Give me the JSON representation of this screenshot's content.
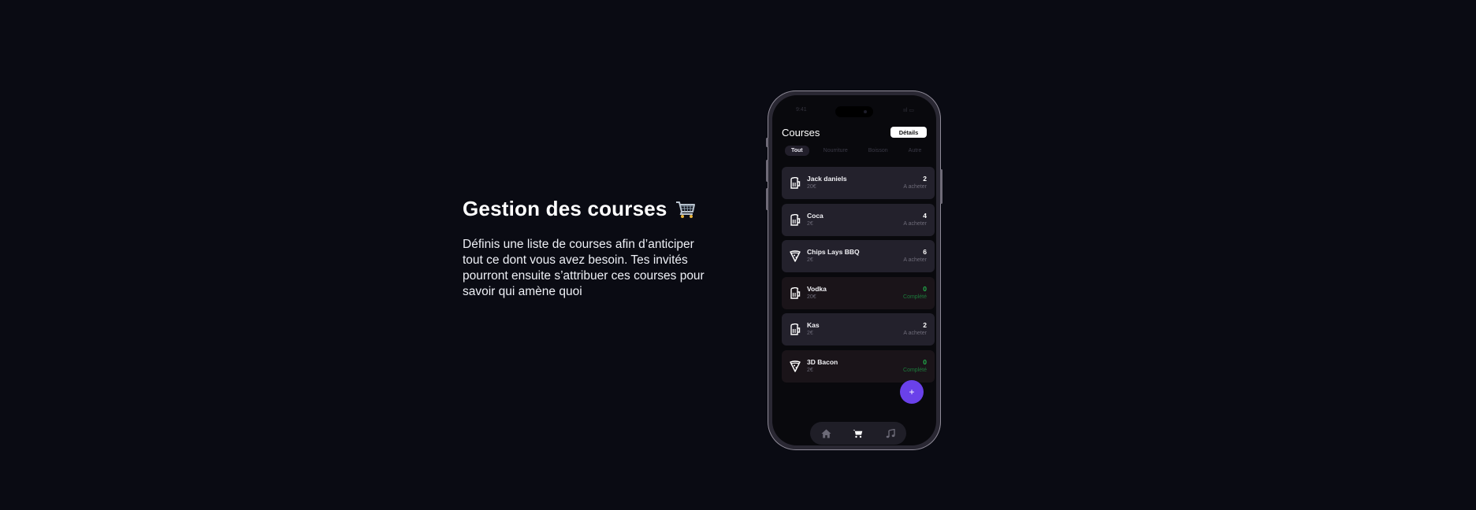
{
  "hero": {
    "title": "Gestion des courses",
    "title_icon": "shopping-cart-emoji",
    "description": "Définis une liste de courses afin d’anticiper tout ce dont vous avez besoin. Tes invités pourront ensuite s’attribuer ces courses pour savoir qui amène quoi"
  },
  "phone": {
    "status_time": "9:41",
    "status_right": "ııl ▭",
    "app": {
      "title": "Courses",
      "details_label": "Détails",
      "tabs": [
        {
          "label": "Tout",
          "active": true
        },
        {
          "label": "Nourriture",
          "active": false
        },
        {
          "label": "Boisson",
          "active": false
        },
        {
          "label": "Autre",
          "active": false
        }
      ],
      "items": [
        {
          "name": "Jack daniels",
          "price": "20€",
          "qty": "2",
          "status": "A acheter",
          "icon": "beer-mug-icon",
          "done": false
        },
        {
          "name": "Coca",
          "price": "2€",
          "qty": "4",
          "status": "A acheter",
          "icon": "beer-mug-icon",
          "done": false
        },
        {
          "name": "Chips Lays BBQ",
          "price": "2€",
          "qty": "6",
          "status": "A acheter",
          "icon": "pizza-slice-icon",
          "done": false
        },
        {
          "name": "Vodka",
          "price": "20€",
          "qty": "0",
          "status": "Complété",
          "icon": "beer-mug-icon",
          "done": true
        },
        {
          "name": "Kas",
          "price": "2€",
          "qty": "2",
          "status": "A acheter",
          "icon": "beer-mug-icon",
          "done": false
        },
        {
          "name": "3D Bacon",
          "price": "2€",
          "qty": "0",
          "status": "Complété",
          "icon": "pizza-slice-icon",
          "done": true
        }
      ],
      "fab_label": "+",
      "nav": [
        "home-icon",
        "cart-icon",
        "music-note-icon"
      ]
    }
  },
  "colors": {
    "background": "#0a0b13",
    "accent": "#6a41ea",
    "complete": "#22b14c"
  }
}
